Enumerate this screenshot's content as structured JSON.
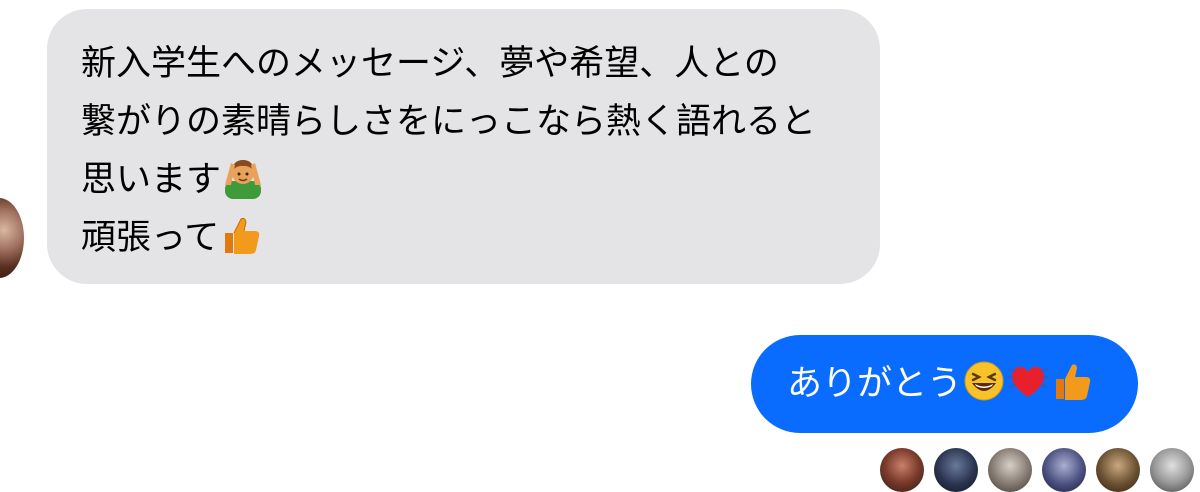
{
  "incoming": {
    "lines": [
      "新入学生へのメッセージ、夢や希望、人との",
      "繋がりの素晴らしさをにっこなら熱く語れると",
      "思います",
      "頑張って"
    ],
    "emojis": {
      "line3": "person-gesturing-ok-emoji",
      "line4": "thumbs-up-emoji"
    }
  },
  "outgoing": {
    "text": "ありがとう",
    "emojis": [
      "grinning-squinting-face-emoji",
      "beating-heart-emoji",
      "thumbs-up-emoji"
    ]
  },
  "colors": {
    "incoming_bubble": "#e4e3e5",
    "outgoing_bubble": "#0a6cff",
    "outgoing_text": "#ffffff",
    "incoming_text": "#000000"
  },
  "read_receipts": {
    "count": 6
  }
}
